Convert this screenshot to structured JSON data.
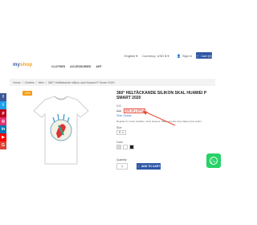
{
  "header": {
    "logo_part1": "my",
    "logo_part2": "shop",
    "language": "English",
    "currency": "Currency: USD $",
    "signin": "Sign in",
    "cart": "Cart (0)",
    "nav": [
      "CLOTHES",
      "ACCESSORIES",
      "ART"
    ]
  },
  "breadcrumb": [
    "Home",
    "Clothes",
    "Men",
    "360° Heltäckande silikon skal Huawei P Smart 2020"
  ],
  "social_icons": [
    "facebook-icon",
    "twitter-icon",
    "pinterest-icon",
    "instagram-icon",
    "linkedin-icon",
    "youtube-icon",
    "google-icon"
  ],
  "social_colors": [
    "#3b5998",
    "#1da1f2",
    "#bd081c",
    "#e1306c",
    "#0077b5",
    "#ff0000",
    "#db4437"
  ],
  "product": {
    "badge": "-20%",
    "title": "360° HELTÄCKANDE SILIKON SKAL HUAWEI P SMART 2020",
    "ref": "$38",
    "price_old": "$38",
    "price_new": "$30.40  (-20%)",
    "size_guide": "Size Guide",
    "description": "Regular fit, round neckline, short sleeves. Made of extra long staple pima cotton.",
    "size_label": "Size",
    "size_value": "S",
    "color_label": "Color",
    "colors": [
      "#d9d9d9",
      "#ffffff",
      "#222222"
    ],
    "qty_label": "Quantity",
    "qty_value": "1",
    "add_to_cart": "ADD TO CART"
  }
}
